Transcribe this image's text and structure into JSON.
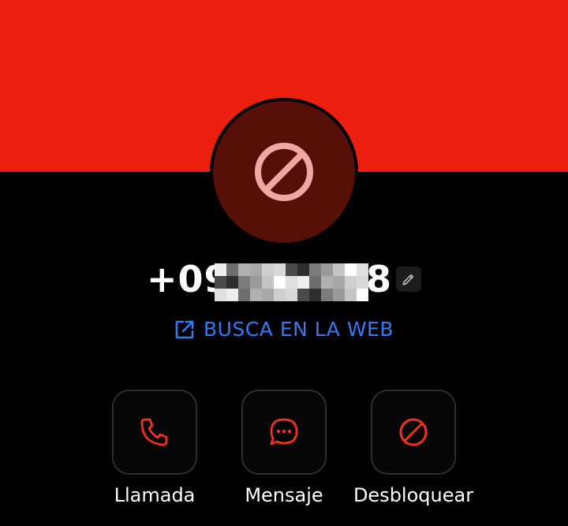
{
  "colors": {
    "header": "#ED1F0E",
    "avatar_bg": "#561008",
    "avatar_icon": "#F3A7A2",
    "accent_red": "#F0321E",
    "link_blue": "#2F7CF6"
  },
  "contact": {
    "number_visible_prefix": "+093",
    "number_visible_suffix": "8",
    "avatar_icon": "block-icon",
    "edit_icon": "pencil-icon"
  },
  "web_search": {
    "label": "BUSCA EN LA WEB",
    "icon": "open-external-icon"
  },
  "actions": [
    {
      "label": "Llamada",
      "icon": "phone-icon"
    },
    {
      "label": "Mensaje",
      "icon": "message-icon"
    },
    {
      "label": "Desbloquear",
      "icon": "block-icon"
    }
  ]
}
